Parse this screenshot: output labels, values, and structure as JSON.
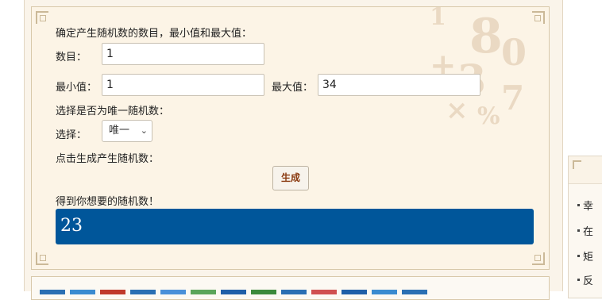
{
  "form": {
    "intro": "确定产生随机数的数目，最小值和最大值：",
    "count_label": "数目：",
    "count_value": "1",
    "min_label": "最小值：",
    "min_value": "1",
    "max_label": "最大值：",
    "max_value": "34",
    "unique_prompt": "选择是否为唯一随机数：",
    "select_label": "选择：",
    "select_value": "唯一",
    "generate_prompt": "点击生成产生随机数：",
    "generate_button": "生成",
    "result_label": "得到你想要的随机数！",
    "result_value": "23"
  },
  "right_list": {
    "items": [
      "幸",
      "在",
      "矩",
      "反"
    ]
  },
  "colors": {
    "result_bg": "#00569a",
    "panel_bg": "#fcf4e6",
    "button_text": "#8a3a10"
  }
}
